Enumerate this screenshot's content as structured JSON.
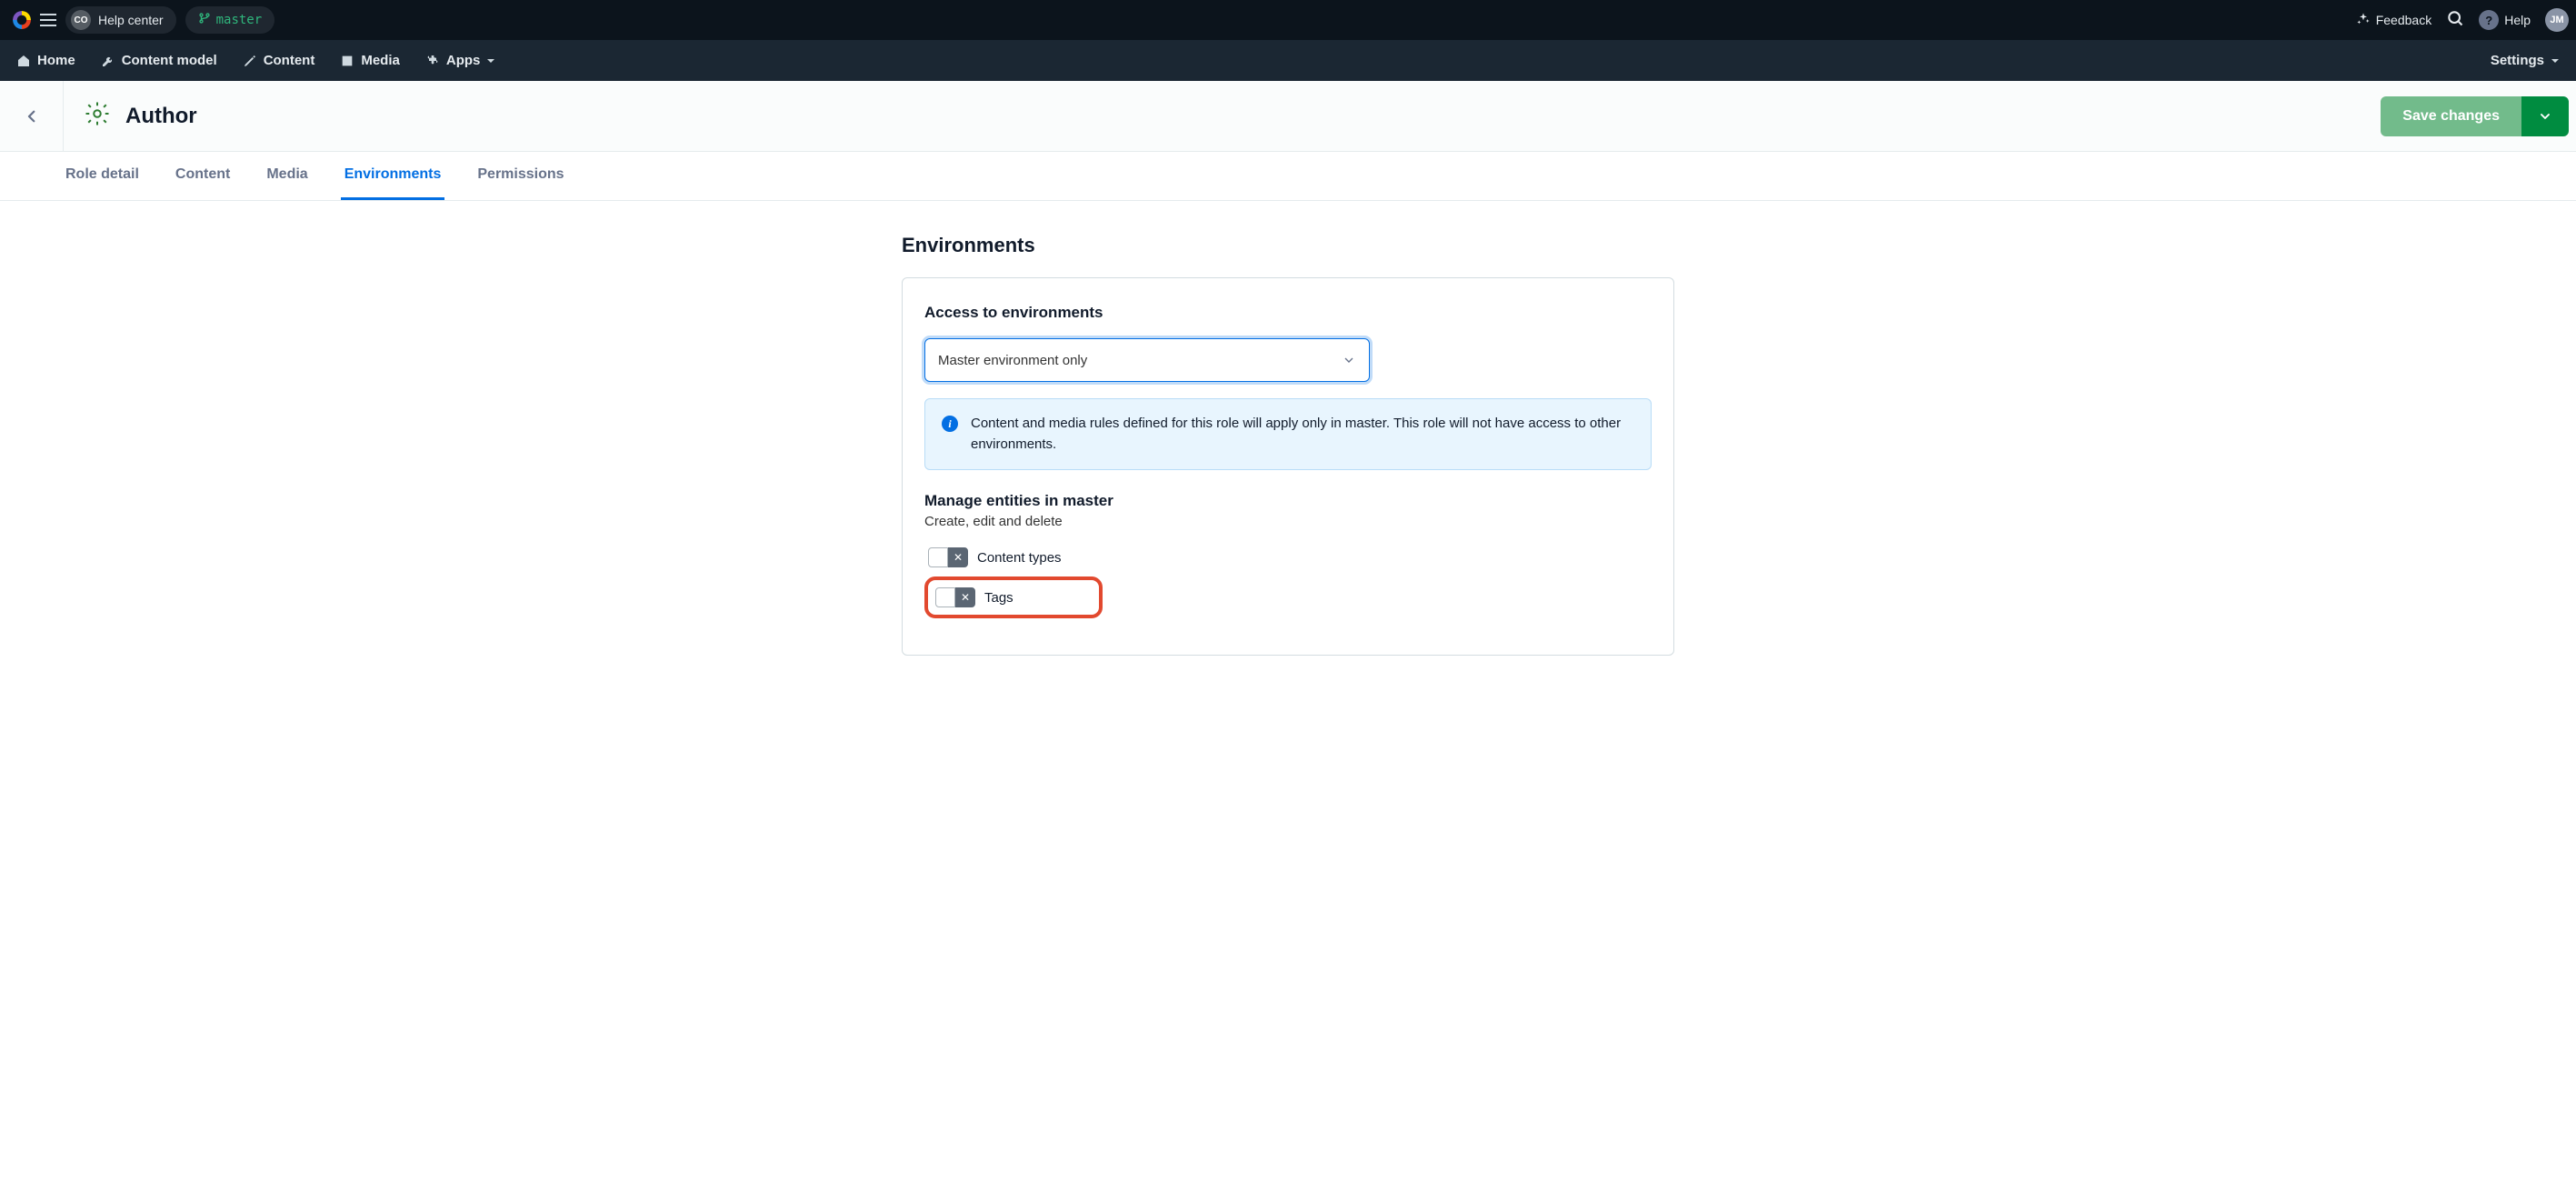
{
  "topbar": {
    "org_badge": "CO",
    "space_name": "Help center",
    "branch": "master",
    "feedback": "Feedback",
    "help": "Help",
    "avatar": "JM"
  },
  "mainnav": {
    "home": "Home",
    "content_model": "Content model",
    "content": "Content",
    "media": "Media",
    "apps": "Apps",
    "settings": "Settings"
  },
  "page": {
    "title": "Author",
    "save": "Save changes"
  },
  "tabs": {
    "role_detail": "Role detail",
    "content": "Content",
    "media": "Media",
    "environments": "Environments",
    "permissions": "Permissions"
  },
  "section": {
    "title": "Environments",
    "access_heading": "Access to environments",
    "select_value": "Master environment only",
    "info_text": "Content and media rules defined for this role will apply only in master. This role will not have access to other environments.",
    "manage_heading": "Manage entities in master",
    "manage_desc": "Create, edit and delete",
    "toggle_content_types": "Content types",
    "toggle_tags": "Tags"
  }
}
